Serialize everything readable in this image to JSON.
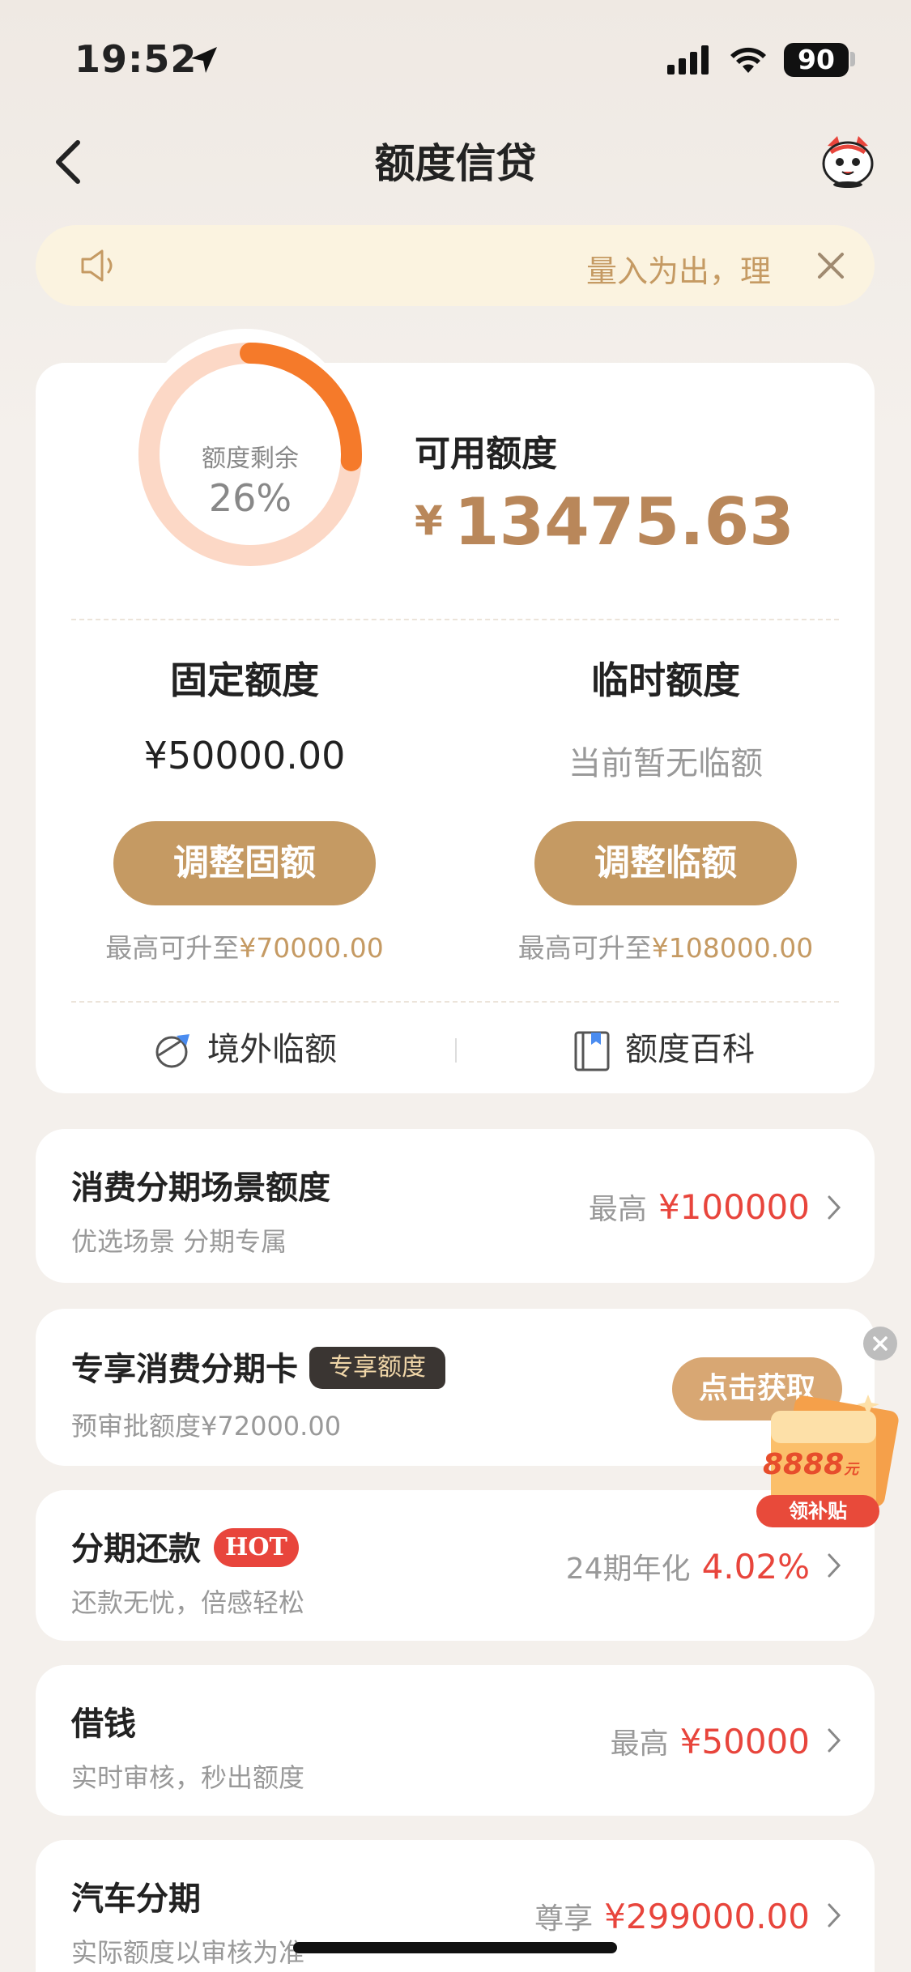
{
  "status_bar": {
    "time": "19:52",
    "battery": "90"
  },
  "nav": {
    "title": "额度信贷"
  },
  "notice": {
    "text": "量入为出，理"
  },
  "credit": {
    "ring_label": "额度剩余",
    "ring_percent_text": "26%",
    "ring_fraction": 0.26,
    "available_label": "可用额度",
    "currency": "¥",
    "available_amount": "13475.63",
    "fixed": {
      "title": "固定额度",
      "amount": "¥50000.00",
      "button": "调整固额",
      "max_prefix": "最高可升至",
      "max_value": "¥70000.00"
    },
    "temp": {
      "title": "临时额度",
      "status": "当前暂无临额",
      "button": "调整临额",
      "max_prefix": "最高可升至",
      "max_value": "¥108000.00"
    },
    "links": [
      {
        "label": "境外临额",
        "icon": "globe-plane-icon"
      },
      {
        "label": "额度百科",
        "icon": "book-icon"
      }
    ]
  },
  "rows": [
    {
      "title": "消费分期场景额度",
      "subtitle": "优选场景 分期专属",
      "right_label": "最高",
      "right_value": "¥100000"
    },
    {
      "title": "专享消费分期卡",
      "tag": "专享额度",
      "subtitle": "预审批额度¥72000.00",
      "button": "点击获取"
    },
    {
      "title": "分期还款",
      "tag": "HOT",
      "subtitle": "还款无忧，倍感轻松",
      "right_label": "24期年化",
      "right_value": "4.02%"
    },
    {
      "title": "借钱",
      "subtitle": "实时审核，秒出额度",
      "right_label": "最高",
      "right_value": "¥50000"
    },
    {
      "title": "汽车分期",
      "subtitle": "实际额度以审核为准",
      "right_label": "尊享",
      "right_value": "¥299000.00"
    }
  ],
  "promo": {
    "amount": "8888",
    "unit": "元",
    "button": "领补贴"
  },
  "colors": {
    "gold": "#c59a63",
    "orange": "#f57a2a",
    "red": "#e8453c",
    "ring_track": "#fcd8c6"
  }
}
